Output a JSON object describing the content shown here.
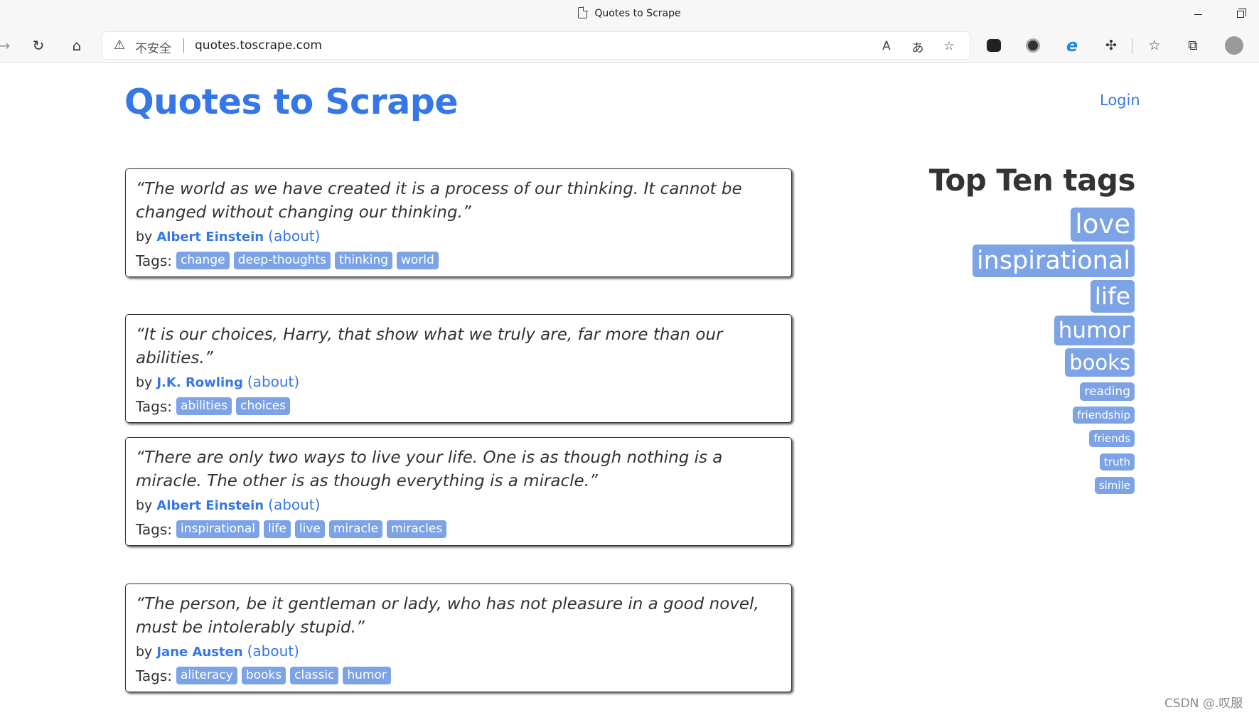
{
  "browser": {
    "window_title": "Quotes to Scrape",
    "insecure_label": "不安全",
    "url": "quotes.toscrape.com"
  },
  "header": {
    "site_title": "Quotes to Scrape",
    "login_label": "Login"
  },
  "quotes": [
    {
      "text": "“The world as we have created it is a process of our thinking. It cannot be changed without changing our thinking.”",
      "by": "by",
      "author": "Albert Einstein",
      "about": "(about)",
      "tags_label": "Tags:",
      "tags": [
        "change",
        "deep-thoughts",
        "thinking",
        "world"
      ]
    },
    {
      "text": "“It is our choices, Harry, that show what we truly are, far more than our abilities.”",
      "by": "by",
      "author": "J.K. Rowling",
      "about": "(about)",
      "tags_label": "Tags:",
      "tags": [
        "abilities",
        "choices"
      ]
    },
    {
      "text": "“There are only two ways to live your life. One is as though nothing is a miracle. The other is as though everything is a miracle.”",
      "by": "by",
      "author": "Albert Einstein",
      "about": "(about)",
      "tags_label": "Tags:",
      "tags": [
        "inspirational",
        "life",
        "live",
        "miracle",
        "miracles"
      ]
    },
    {
      "text": "“The person, be it gentleman or lady, who has not pleasure in a good novel, must be intolerably stupid.”",
      "by": "by",
      "author": "Jane Austen",
      "about": "(about)",
      "tags_label": "Tags:",
      "tags": [
        "aliteracy",
        "books",
        "classic",
        "humor"
      ]
    }
  ],
  "top_tags": {
    "heading": "Top Ten tags",
    "items": [
      "love",
      "inspirational",
      "life",
      "humor",
      "books",
      "reading",
      "friendship",
      "friends",
      "truth",
      "simile"
    ]
  },
  "watermark": "CSDN @.叹服"
}
